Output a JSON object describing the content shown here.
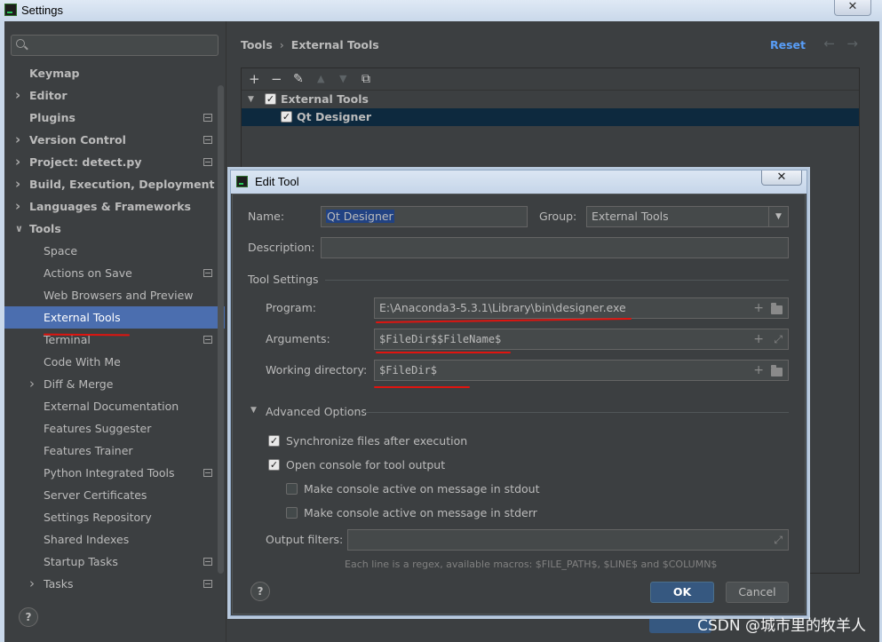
{
  "window": {
    "title": "Settings",
    "close_glyph": "✕"
  },
  "sidebar": {
    "search_placeholder": "",
    "items": [
      {
        "label": "Keymap",
        "level": 0,
        "bold": true,
        "arrow": false,
        "icon": false
      },
      {
        "label": "Editor",
        "level": 0,
        "bold": true,
        "arrow": true,
        "icon": false
      },
      {
        "label": "Plugins",
        "level": 0,
        "bold": true,
        "arrow": false,
        "icon": true
      },
      {
        "label": "Version Control",
        "level": 0,
        "bold": true,
        "arrow": true,
        "icon": true
      },
      {
        "label": "Project: detect.py",
        "level": 0,
        "bold": true,
        "arrow": true,
        "icon": true
      },
      {
        "label": "Build, Execution, Deployment",
        "level": 0,
        "bold": true,
        "arrow": true,
        "icon": false
      },
      {
        "label": "Languages & Frameworks",
        "level": 0,
        "bold": true,
        "arrow": true,
        "icon": false
      },
      {
        "label": "Tools",
        "level": 0,
        "bold": true,
        "arrow": true,
        "expanded": true,
        "icon": false
      },
      {
        "label": "Space",
        "level": 1,
        "bold": false,
        "arrow": false,
        "icon": false
      },
      {
        "label": "Actions on Save",
        "level": 1,
        "bold": false,
        "arrow": false,
        "icon": true
      },
      {
        "label": "Web Browsers and Preview",
        "level": 1,
        "bold": false,
        "arrow": false,
        "icon": false
      },
      {
        "label": "External Tools",
        "level": 1,
        "bold": false,
        "arrow": false,
        "icon": false,
        "selected": true
      },
      {
        "label": "Terminal",
        "level": 1,
        "bold": false,
        "arrow": false,
        "icon": true
      },
      {
        "label": "Code With Me",
        "level": 1,
        "bold": false,
        "arrow": false,
        "icon": false
      },
      {
        "label": "Diff & Merge",
        "level": 1,
        "bold": false,
        "arrow": true,
        "icon": false
      },
      {
        "label": "External Documentation",
        "level": 1,
        "bold": false,
        "arrow": false,
        "icon": false
      },
      {
        "label": "Features Suggester",
        "level": 1,
        "bold": false,
        "arrow": false,
        "icon": false
      },
      {
        "label": "Features Trainer",
        "level": 1,
        "bold": false,
        "arrow": false,
        "icon": false
      },
      {
        "label": "Python Integrated Tools",
        "level": 1,
        "bold": false,
        "arrow": false,
        "icon": true
      },
      {
        "label": "Server Certificates",
        "level": 1,
        "bold": false,
        "arrow": false,
        "icon": false
      },
      {
        "label": "Settings Repository",
        "level": 1,
        "bold": false,
        "arrow": false,
        "icon": false
      },
      {
        "label": "Shared Indexes",
        "level": 1,
        "bold": false,
        "arrow": false,
        "icon": false
      },
      {
        "label": "Startup Tasks",
        "level": 1,
        "bold": false,
        "arrow": false,
        "icon": true
      },
      {
        "label": "Tasks",
        "level": 1,
        "bold": false,
        "arrow": true,
        "icon": true
      }
    ],
    "help_label": "?"
  },
  "main": {
    "breadcrumb": {
      "parent": "Tools",
      "separator": "›",
      "current": "External Tools"
    },
    "reset_label": "Reset",
    "back_glyph": "←",
    "forward_glyph": "→",
    "toolbar": {
      "add": "+",
      "remove": "−",
      "edit": "✎",
      "up": "▲",
      "down": "▼",
      "copy": "⧉"
    },
    "tools": [
      {
        "label": "External Tools",
        "checked": true,
        "expanded": true
      },
      {
        "label": "Qt Designer",
        "checked": true,
        "selected": true
      }
    ]
  },
  "dialog": {
    "title": "Edit Tool",
    "close_glyph": "✕",
    "name_label": "Name:",
    "name_value": "Qt Designer",
    "group_label": "Group:",
    "group_value": "External Tools",
    "description_label": "Description:",
    "description_value": "",
    "tool_settings_title": "Tool Settings",
    "program_label": "Program:",
    "program_value": "E:\\Anaconda3-5.3.1\\Library\\bin\\designer.exe",
    "arguments_label": "Arguments:",
    "arguments_value": "$FileDir$$FileName$",
    "working_dir_label": "Working directory:",
    "working_dir_value": "$FileDir$",
    "advanced_title": "Advanced Options",
    "options": [
      {
        "label": "Synchronize files after execution",
        "checked": true,
        "indent": 0
      },
      {
        "label": "Open console for tool output",
        "checked": true,
        "indent": 0
      },
      {
        "label": "Make console active on message in stdout",
        "checked": false,
        "indent": 1
      },
      {
        "label": "Make console active on message in stderr",
        "checked": false,
        "indent": 1
      }
    ],
    "output_filters_label": "Output filters:",
    "output_filters_value": "",
    "hint": "Each line is a regex, available macros: $FILE_PATH$, $LINE$ and $COLUMN$",
    "help_label": "?",
    "ok_label": "OK",
    "cancel_label": "Cancel"
  },
  "watermark": "CSDN @城市里的牧羊人",
  "colors": {
    "accent": "#4b6eaf",
    "link": "#589df6",
    "annotation": "#e0140f",
    "ok_button": "#365880"
  }
}
